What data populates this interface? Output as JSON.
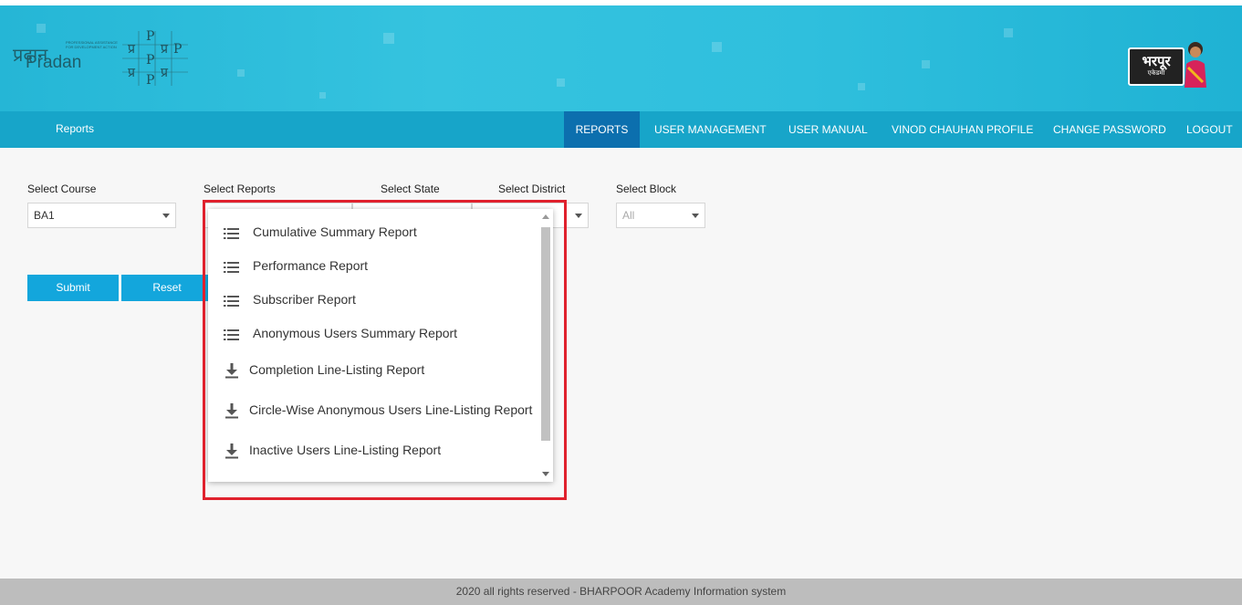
{
  "header": {
    "logo_hindi": "प्रदान",
    "logo_english": "Pradan",
    "logo_tagline": "PROFESSIONAL ASSISTANCE FOR DEVELOPMENT ACTION",
    "badge_line1": "भरपूर",
    "badge_line2": "एकेडमी"
  },
  "nav": {
    "left_title": "Reports",
    "items": [
      {
        "label": "REPORTS",
        "active": true
      },
      {
        "label": "USER MANAGEMENT"
      },
      {
        "label": "USER MANUAL"
      },
      {
        "label": "VINOD CHAUHAN PROFILE"
      },
      {
        "label": "CHANGE PASSWORD"
      },
      {
        "label": "LOGOUT"
      }
    ]
  },
  "filters": {
    "course": {
      "label": "Select Course",
      "value": "BA1"
    },
    "reports": {
      "label": "Select Reports",
      "value": ""
    },
    "state": {
      "label": "Select State",
      "value": ""
    },
    "district": {
      "label": "Select District",
      "value": ""
    },
    "block": {
      "label": "Select Block",
      "value": "All"
    }
  },
  "buttons": {
    "submit": "Submit",
    "reset": "Reset"
  },
  "dropdown": {
    "items": [
      {
        "label": "Cumulative Summary Report",
        "icon": "list-icon"
      },
      {
        "label": "Performance Report",
        "icon": "list-icon"
      },
      {
        "label": "Subscriber Report",
        "icon": "list-icon"
      },
      {
        "label": "Anonymous Users Summary Report",
        "icon": "list-icon"
      },
      {
        "label": "Completion Line-Listing Report",
        "icon": "download-icon"
      },
      {
        "label": "Circle-Wise Anonymous Users Line-Listing Report",
        "icon": "download-icon"
      },
      {
        "label": "Inactive Users Line-Listing Report",
        "icon": "download-icon"
      }
    ]
  },
  "footer": {
    "text": "2020 all rights reserved - BHARPOOR Academy Information system"
  },
  "colors": {
    "navbar": "#17a5c9",
    "nav_active": "#0c6fae",
    "button": "#13a6dc",
    "highlight": "#e0212d",
    "footer": "#bdbdbd"
  }
}
